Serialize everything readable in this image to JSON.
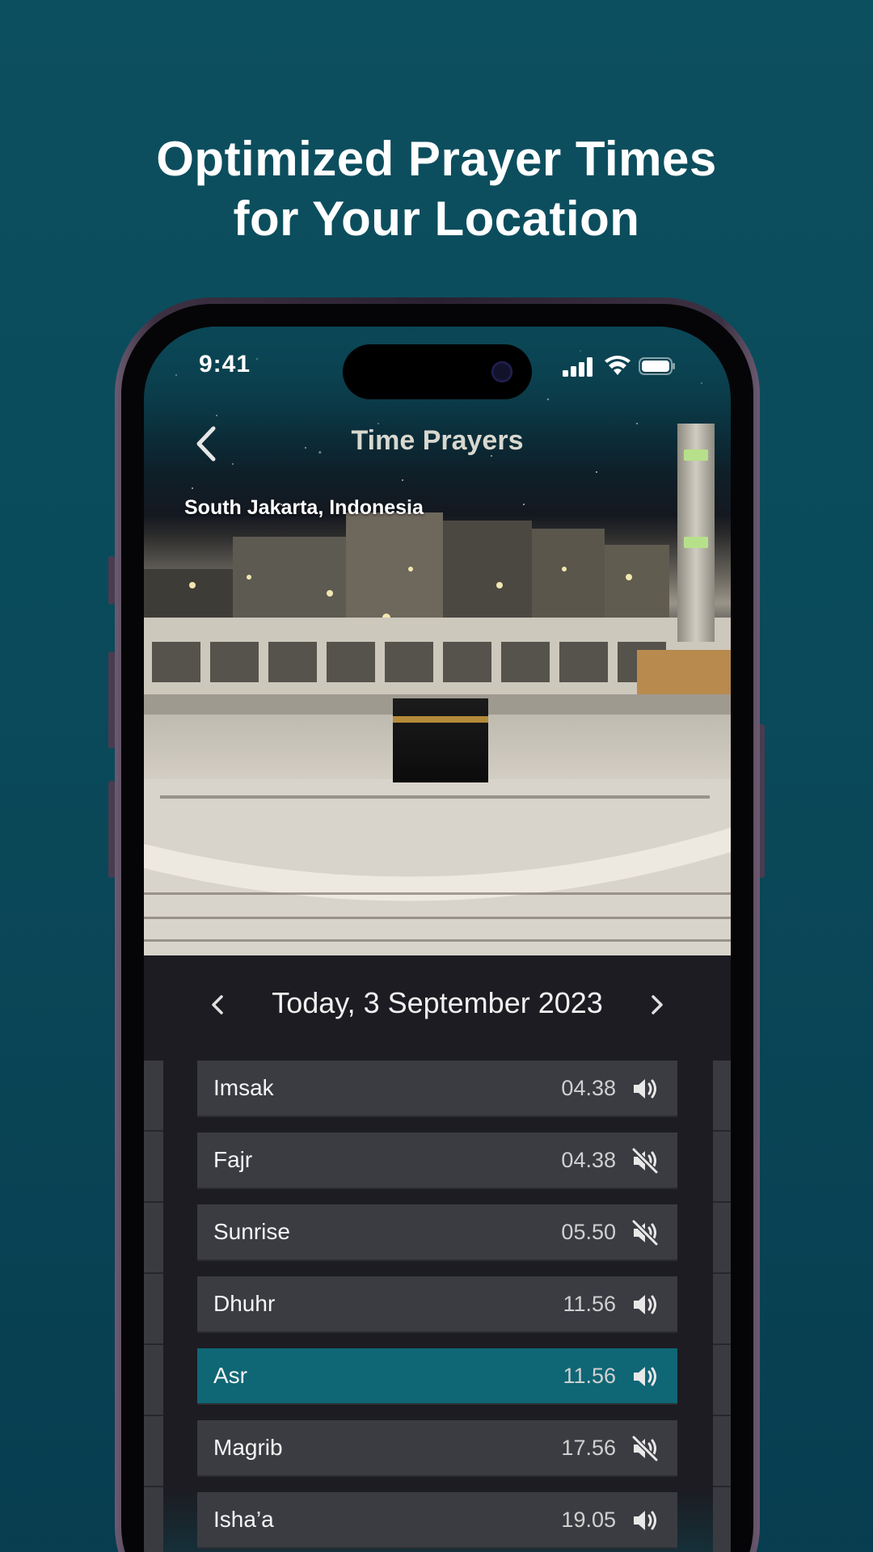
{
  "headline": {
    "line1": "Optimized Prayer Times",
    "line2": "for Your Location"
  },
  "status_bar": {
    "time": "9:41"
  },
  "app": {
    "title": "Time Prayers",
    "location": "South Jakarta, Indonesia",
    "date": "Today, 3 September 2023"
  },
  "prayers": [
    {
      "name": "Imsak",
      "time": "04.38",
      "sound": "on",
      "icon": "speaker-icon"
    },
    {
      "name": "Fajr",
      "time": "04.38",
      "sound": "off",
      "icon": "speaker-muted-icon"
    },
    {
      "name": "Sunrise",
      "time": "05.50",
      "sound": "off",
      "icon": "speaker-muted-icon"
    },
    {
      "name": "Dhuhr",
      "time": "11.56",
      "sound": "on",
      "icon": "speaker-icon"
    },
    {
      "name": "Asr",
      "time": "11.56",
      "sound": "on",
      "icon": "speaker-icon",
      "active": true
    },
    {
      "name": "Magrib",
      "time": "17.56",
      "sound": "off",
      "icon": "speaker-muted-icon"
    },
    {
      "name": "Isha’a",
      "time": "19.05",
      "sound": "on",
      "icon": "speaker-icon"
    }
  ],
  "colors": {
    "background": "#0a4a5a",
    "active_row": "#0f6675",
    "row": "#3b3c42",
    "panel": "#1c1c22"
  }
}
